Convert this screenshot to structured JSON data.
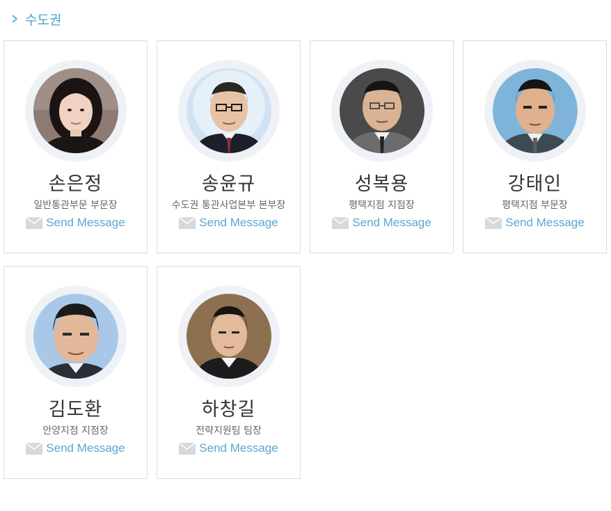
{
  "section": {
    "title": "수도권",
    "icon": "chevron-right-icon",
    "accent_color": "#4aa0cc"
  },
  "send_message_label": "Send Message",
  "members": [
    {
      "name": "손은정",
      "title": "일반통관부문 부문장"
    },
    {
      "name": "송윤규",
      "title": "수도권 통관사업본부 본부장"
    },
    {
      "name": "성복용",
      "title": "평택지점 지점장"
    },
    {
      "name": "강태인",
      "title": "평택지점 부문장"
    },
    {
      "name": "김도환",
      "title": "안양지점 지점장"
    },
    {
      "name": "하창길",
      "title": "전략지원팀 팀장"
    }
  ]
}
